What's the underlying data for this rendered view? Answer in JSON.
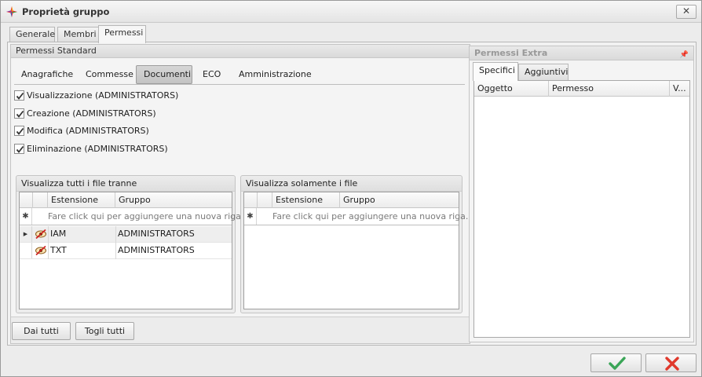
{
  "window": {
    "title": "Proprietà gruppo",
    "close_label": "✕"
  },
  "top_tabs": [
    {
      "label": "Generale"
    },
    {
      "label": "Membri"
    },
    {
      "label": "Permessi",
      "active": true
    }
  ],
  "standard_panel": {
    "title": "Permessi Standard",
    "subtabs": [
      {
        "label": "Anagrafiche"
      },
      {
        "label": "Commesse"
      },
      {
        "label": "Documenti",
        "active": true
      },
      {
        "label": "ECO"
      },
      {
        "label": "Amministrazione"
      }
    ],
    "permissions": [
      {
        "label": "Visualizzazione (ADMINISTRATORS)",
        "checked": true
      },
      {
        "label": "Creazione (ADMINISTRATORS)",
        "checked": true
      },
      {
        "label": "Modifica (ADMINISTRATORS)",
        "checked": true
      },
      {
        "label": "Eliminazione (ADMINISTRATORS)",
        "checked": true
      }
    ],
    "exclude_group": {
      "title": "Visualizza tutti i file tranne",
      "columns": [
        "Estensione",
        "Gruppo"
      ],
      "new_row_text": "Fare click qui per aggiungere una nuova riga.",
      "new_row_marker": "✱",
      "rows": [
        {
          "extension": "IAM",
          "group": "ADMINISTRATORS",
          "selected": true
        },
        {
          "extension": "TXT",
          "group": "ADMINISTRATORS"
        }
      ]
    },
    "only_group": {
      "title": "Visualizza solamente i file",
      "columns": [
        "Estensione",
        "Gruppo"
      ],
      "new_row_text": "Fare click qui per aggiungere una nuova riga.",
      "new_row_marker": "✱",
      "rows": []
    },
    "buttons": {
      "give_all": "Dai tutti",
      "remove_all": "Togli tutti"
    }
  },
  "extra_panel": {
    "title": "Permessi Extra",
    "pin_icon": "pin-icon",
    "tabs": [
      {
        "label": "Specifici",
        "active": true
      },
      {
        "label": "Aggiuntivi"
      }
    ],
    "columns": [
      "Oggetto",
      "Permesso",
      "V..."
    ]
  },
  "footer": {
    "ok_icon": "checkmark-icon",
    "cancel_icon": "cross-icon"
  },
  "colors": {
    "ok_green": "#3aa557",
    "cancel_red": "#e0392c",
    "extra_title_gray": "#999999"
  }
}
